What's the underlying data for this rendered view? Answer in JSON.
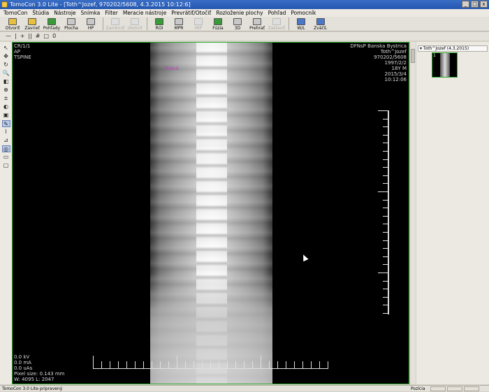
{
  "window": {
    "title": "TomoCon 3.0 Lite - [Toth^Jozef, 970202/5608, 4.3.2015 10:12:6]",
    "buttons": [
      "_",
      "□",
      "x"
    ]
  },
  "menu": [
    "TomoCon",
    "Štúdia",
    "Nástroje",
    "Snímka",
    "Filter",
    "Meracie nástroje",
    "Prevrátiť/Otočiť",
    "Rozloženie plochy",
    "Pohľad",
    "Pomocník"
  ],
  "toolbar": [
    {
      "label": "Otvoriť",
      "icon": "folder-open-icon",
      "enabled": true
    },
    {
      "label": "Zavrieť",
      "icon": "folder-close-icon",
      "enabled": true
    },
    {
      "label": "Pohľady",
      "icon": "views-icon",
      "enabled": true
    },
    {
      "label": "Plocha",
      "icon": "layout-icon",
      "enabled": true
    },
    {
      "label": "HP",
      "icon": "hanging-protocol-icon",
      "enabled": true
    },
    {
      "label": "Zamknúť",
      "icon": "lock-icon",
      "enabled": false
    },
    {
      "label": "Ukotviť",
      "icon": "anchor-icon",
      "enabled": false
    },
    {
      "label": "ROI",
      "icon": "roi-icon",
      "enabled": true
    },
    {
      "label": "MPR",
      "icon": "mpr-icon",
      "enabled": true
    },
    {
      "label": "MIP",
      "icon": "mip-icon",
      "enabled": false
    },
    {
      "label": "Fúzia",
      "icon": "fusion-icon",
      "enabled": true
    },
    {
      "label": "3D",
      "icon": "3d-icon",
      "enabled": true
    },
    {
      "label": "Prehrať",
      "icon": "play-icon",
      "enabled": true
    },
    {
      "label": "Zastaviť",
      "icon": "stop-icon",
      "enabled": false
    },
    {
      "label": "W/L",
      "icon": "window-level-icon",
      "enabled": true
    },
    {
      "label": "Zväčš.",
      "icon": "zoom-icon",
      "enabled": true
    }
  ],
  "toolbar2": [
    "—",
    "|",
    "+",
    "||",
    "#",
    "□",
    "0"
  ],
  "lefttools": [
    "↖",
    "✥",
    "↻",
    "🔍",
    "◧",
    "⊕",
    "±",
    "◐",
    "▣",
    "✎",
    "⌇",
    "⊿",
    "◎",
    "▭",
    "▢"
  ],
  "overlay": {
    "top_left": [
      "CR/1/1",
      "AP",
      "TSPINE"
    ],
    "top_right": [
      "DFNsP Banska Bystrica",
      "Toth^Jozef",
      "970202/5608",
      "1997/2/2",
      "18Y M",
      "2015/3/4",
      "10:12:06"
    ],
    "bottom_left": [
      "0.0 kV",
      "0.0 mA",
      "0.0 uAs",
      "Pixel size: 0.143 mm",
      "W: 4095 L: 2047"
    ],
    "marker": "Pravá"
  },
  "series_panel": {
    "header": "Toth^Jozef (4.3.2015)",
    "thumb_number": "1"
  },
  "statusbar": {
    "text": "TomoCon 3.0 Lite pripravený",
    "position_label": "Pozícia"
  }
}
